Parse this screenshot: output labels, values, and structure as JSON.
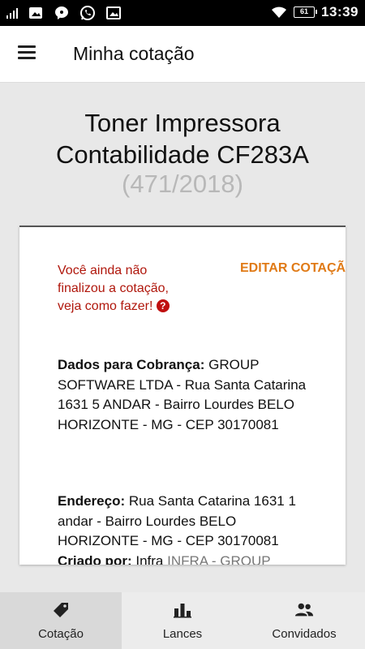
{
  "status_bar": {
    "time": "13:39",
    "battery": "61",
    "icons": [
      "signal-icon",
      "gallery-icon",
      "chat-icon",
      "whatsapp-icon",
      "image-icon",
      "wifi-icon",
      "battery-icon"
    ]
  },
  "app_bar": {
    "title": "Minha cotação",
    "menu_icon": "menu-icon"
  },
  "quote": {
    "title_line1": "Toner Impressora",
    "title_line2": "Contabilidade CF283A",
    "number": "(471/2018)"
  },
  "card": {
    "warning_text": "Você ainda não finalizou a cotação, veja como fazer!",
    "help_icon": "?",
    "edit_label": "EDITAR COTAÇÃO",
    "billing_label": "Dados para Cobrança:",
    "billing_value": "GROUP SOFTWARE LTDA - Rua Santa Catarina 1631 5 ANDAR - Bairro Lourdes BELO HORIZONTE - MG - CEP 30170081",
    "address_label": "Endereço:",
    "address_value": "Rua Santa Catarina 1631 1 andar - Bairro Lourdes BELO HORIZONTE - MG - CEP 30170081",
    "creator_label": "Criado por:",
    "creator_value": "Infra",
    "creator_extra": "INFRA - GROUP"
  },
  "bottom_nav": [
    {
      "label": "Cotação",
      "icon": "tag-icon",
      "active": true
    },
    {
      "label": "Lances",
      "icon": "bar-chart-icon",
      "active": false
    },
    {
      "label": "Convidados",
      "icon": "people-icon",
      "active": false
    }
  ],
  "colors": {
    "warning": "#b0170c",
    "accent": "#e07a16",
    "muted_number": "#b8b8b8"
  }
}
